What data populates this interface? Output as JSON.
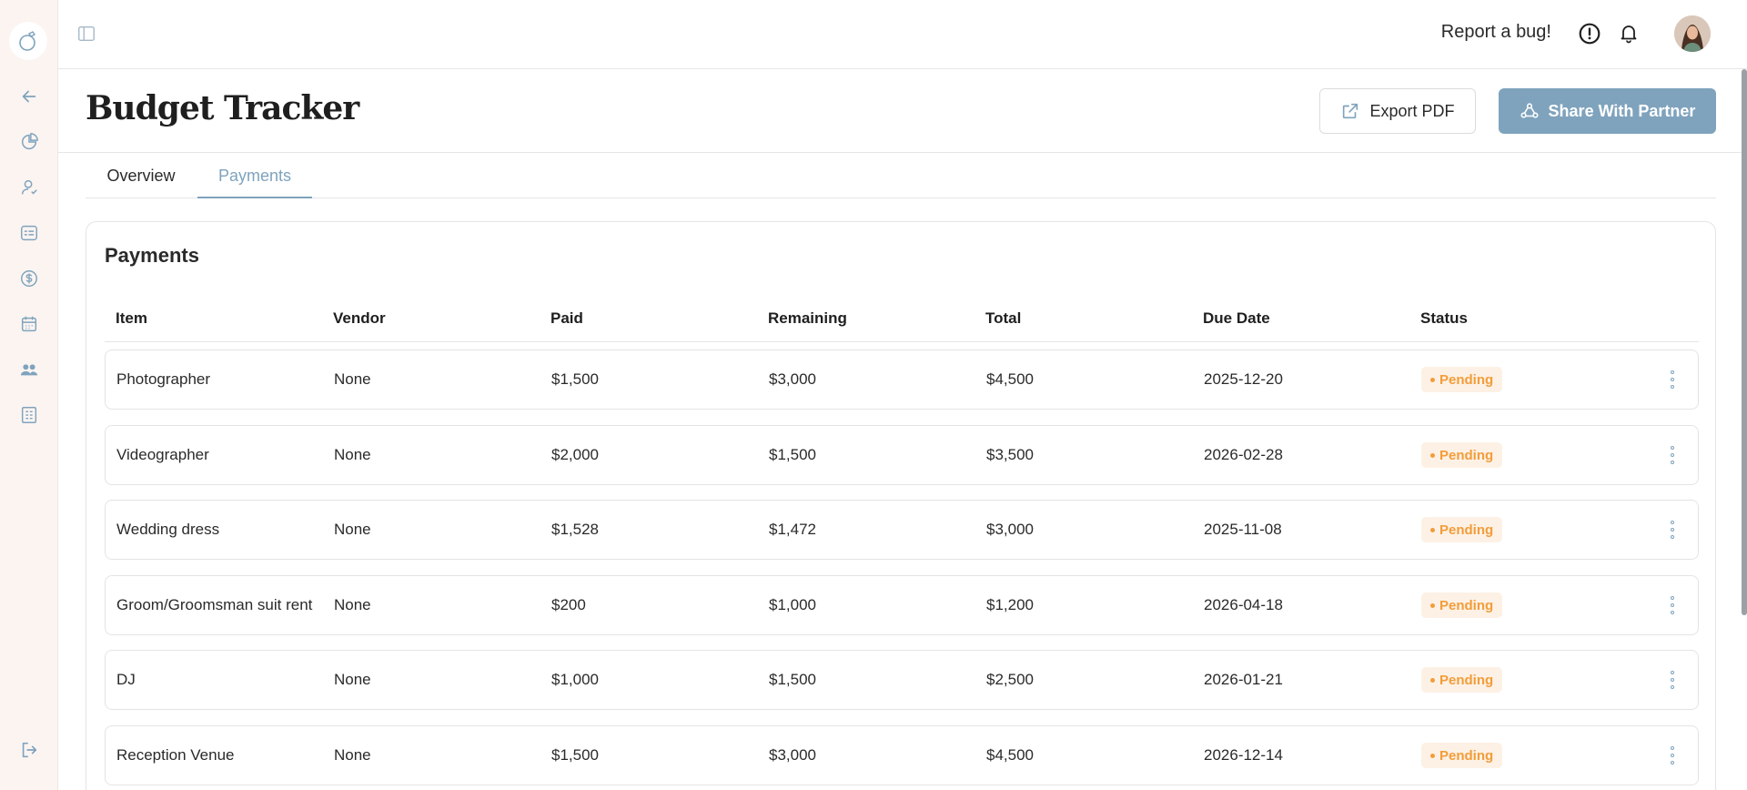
{
  "topbar": {
    "report_bug": "Report a bug!",
    "icons": [
      "panel-toggle-icon",
      "alert-icon",
      "bell-icon"
    ]
  },
  "header": {
    "title": "Budget Tracker",
    "export_label": "Export PDF",
    "share_label": "Share With Partner"
  },
  "tabs": [
    {
      "label": "Overview",
      "active": false
    },
    {
      "label": "Payments",
      "active": true
    }
  ],
  "payments": {
    "title": "Payments",
    "columns": [
      "Item",
      "Vendor",
      "Paid",
      "Remaining",
      "Total",
      "Due Date",
      "Status"
    ],
    "rows": [
      {
        "item": "Photographer",
        "vendor": "None",
        "paid": "$1,500",
        "remaining": "$3,000",
        "total": "$4,500",
        "due": "2025-12-20",
        "status": "Pending"
      },
      {
        "item": "Videographer",
        "vendor": "None",
        "paid": "$2,000",
        "remaining": "$1,500",
        "total": "$3,500",
        "due": "2026-02-28",
        "status": "Pending"
      },
      {
        "item": "Wedding dress",
        "vendor": "None",
        "paid": "$1,528",
        "remaining": "$1,472",
        "total": "$3,000",
        "due": "2025-11-08",
        "status": "Pending"
      },
      {
        "item": "Groom/Groomsman suit rent",
        "vendor": "None",
        "paid": "$200",
        "remaining": "$1,000",
        "total": "$1,200",
        "due": "2026-04-18",
        "status": "Pending"
      },
      {
        "item": "DJ",
        "vendor": "None",
        "paid": "$1,000",
        "remaining": "$1,500",
        "total": "$2,500",
        "due": "2026-01-21",
        "status": "Pending"
      },
      {
        "item": "Reception Venue",
        "vendor": "None",
        "paid": "$1,500",
        "remaining": "$3,000",
        "total": "$4,500",
        "due": "2026-12-14",
        "status": "Pending"
      }
    ]
  },
  "sidebar": {
    "icons": [
      "back-arrow-icon",
      "pie-chart-icon",
      "user-icon",
      "checklist-icon",
      "dollar-icon",
      "calendar-icon",
      "people-icon",
      "table-icon",
      "logout-icon"
    ]
  },
  "colors": {
    "accent": "#7fa3bd",
    "pending_text": "#f29d3a",
    "pending_bg": "#fdf1e5",
    "sidebar_bg": "#fbf4f1"
  }
}
